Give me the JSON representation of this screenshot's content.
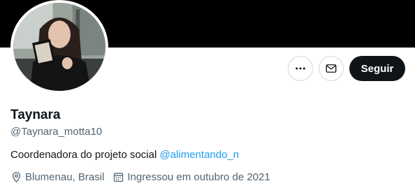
{
  "profile": {
    "name": "Taynara",
    "handle": "@Taynara_motta10",
    "bio_text": "Coordenadora do projeto social ",
    "bio_mention": "@alimentando_n",
    "location": "Blumenau, Brasil",
    "joined": "Ingressou em outubro de 2021"
  },
  "actions": {
    "more_icon": "more-horizontal-icon",
    "message_icon": "envelope-icon",
    "follow_label": "Seguir"
  },
  "colors": {
    "banner": "#000000",
    "text_primary": "#0f1419",
    "text_secondary": "#536471",
    "link": "#1d9bf0",
    "button_dark": "#0f1419"
  }
}
